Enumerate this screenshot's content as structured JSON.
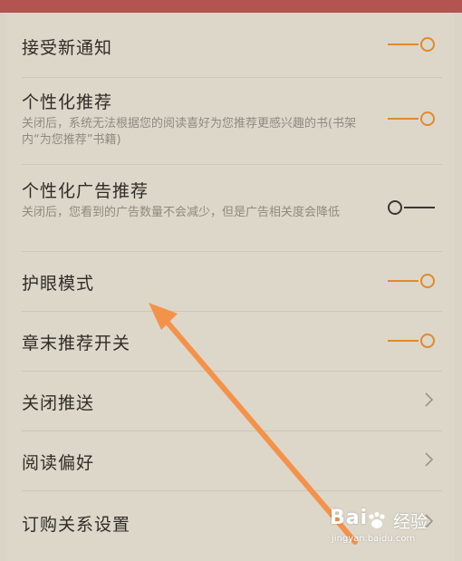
{
  "settings": {
    "items": [
      {
        "title": "接受新通知",
        "type": "toggle",
        "on": true
      },
      {
        "title": "个性化推荐",
        "desc": "关闭后，系统无法根据您的阅读喜好为您推荐更感兴趣的书(书架内“为您推荐”书籍)",
        "type": "toggle",
        "on": true
      },
      {
        "title": "个性化广告推荐",
        "desc": "关闭后，您看到的广告数量不会减少，但是广告相关度会降低",
        "type": "toggle",
        "on": false
      },
      {
        "title": "护眼模式",
        "type": "toggle",
        "on": true
      },
      {
        "title": "章末推荐开关",
        "type": "toggle",
        "on": true
      },
      {
        "title": "关闭推送",
        "type": "link"
      },
      {
        "title": "阅读偏好",
        "type": "link"
      },
      {
        "title": "订购关系设置",
        "type": "link"
      }
    ]
  },
  "colors": {
    "accent": "#e08a2c",
    "off": "#3a3835",
    "topbar": "#b35450",
    "annotation_arrow": "#f5924a"
  },
  "watermark": {
    "logo": "Bai",
    "logo_suffix": "经验",
    "url": "jingyan.baidu.com"
  }
}
